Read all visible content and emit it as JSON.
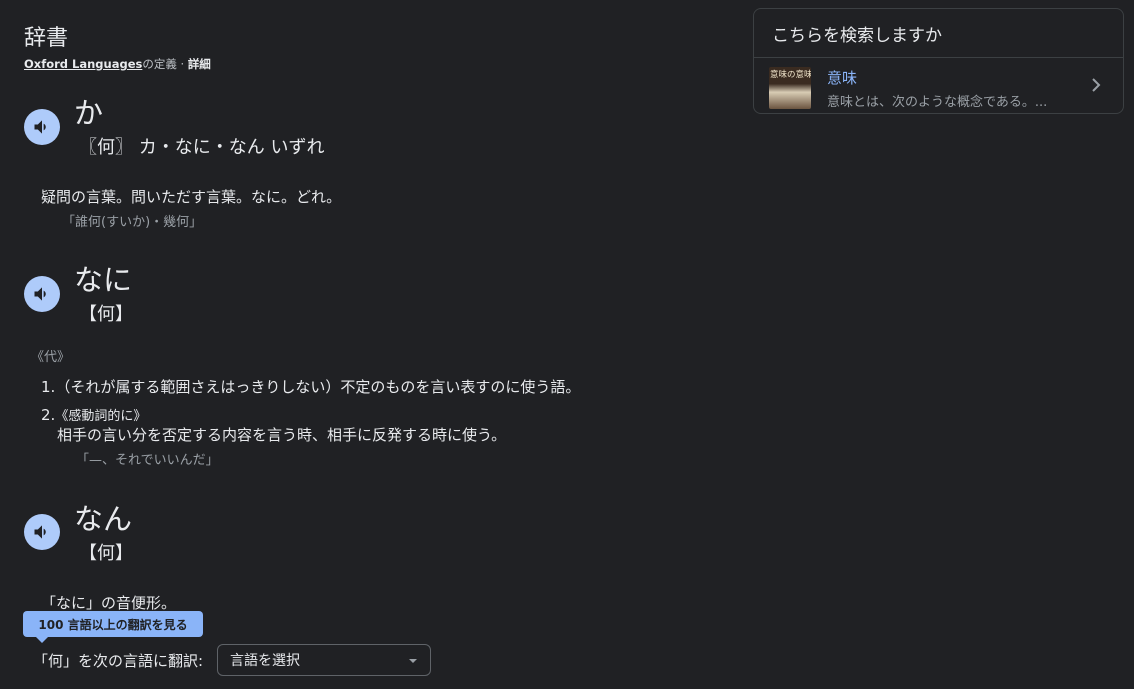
{
  "header": {
    "title": "辞書",
    "source_link": "Oxford Languages",
    "source_suffix": "の定義 · ",
    "detail_link": "詳細"
  },
  "entries": [
    {
      "headword": "か",
      "reading": "〖何〗 カ・なに・なん いずれ",
      "definition": "疑問の言葉。問いただす言葉。なに。どれ。",
      "example": "「誰何(すいか)・幾何」"
    },
    {
      "headword": "なに",
      "reading": "【何】",
      "pos": "《代》",
      "senses": [
        {
          "num": "1.",
          "text": "（それが属する範囲さえはっきりしない）不定のものを言い表すのに使う語。"
        },
        {
          "num": "2.",
          "label": "《感動詞的に》",
          "text": "相手の言い分を否定する内容を言う時、相手に反発する時に使う。",
          "example": "「—、それでいいんだ」"
        }
      ]
    },
    {
      "headword": "なん",
      "reading": "【何】",
      "definition": "「なに」の音便形。"
    }
  ],
  "sidebar": {
    "heading": "こちらを検索しますか",
    "item": {
      "thumb_text": "意味の意味",
      "title": "意味",
      "description": "意味とは、次のような概念である。..."
    }
  },
  "translate": {
    "tooltip": "100 言語以上の翻訳を見る",
    "label": "「何」を次の言語に翻訳:",
    "select_value": "言語を選択"
  },
  "colors": {
    "background": "#202124",
    "speaker_button": "#aecbfa",
    "link_blue": "#8ab4f8"
  }
}
